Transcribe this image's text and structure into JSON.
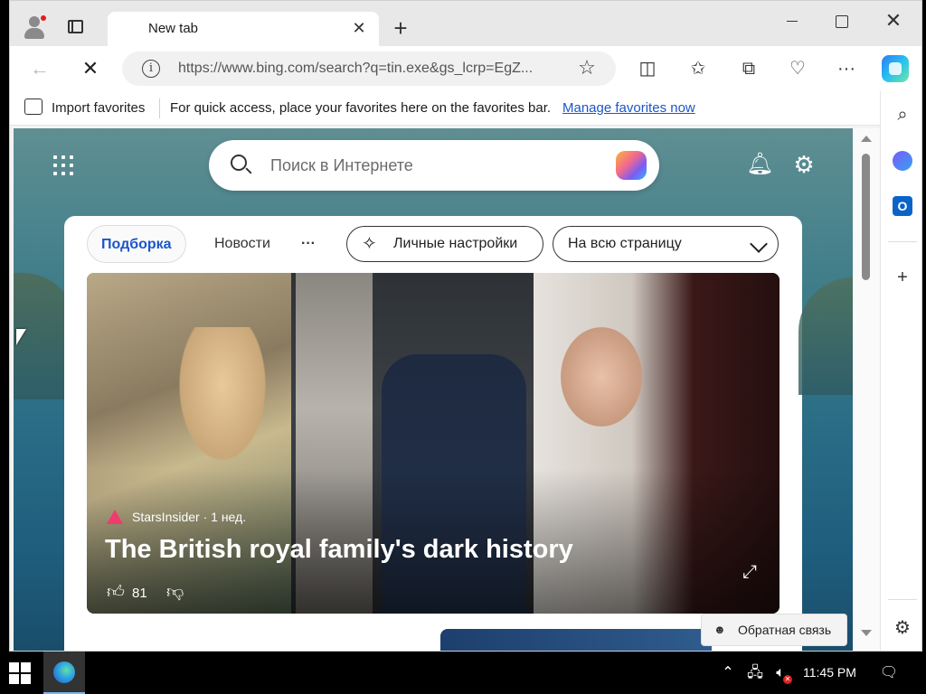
{
  "browser": {
    "tab_title": "New tab",
    "url": "https://www.bing.com/search?q=tin.exe&gs_lcrp=EgZ...",
    "favorites_bar": {
      "import_label": "Import favorites",
      "hint": "For quick access, place your favorites here on the favorites bar.",
      "manage_link": "Manage favorites now"
    }
  },
  "page": {
    "search_placeholder": "Поиск в Интернете",
    "feed_tabs": [
      "Подборка",
      "Новости",
      "···"
    ],
    "personal_settings": "Личные настройки",
    "layout_select": "На всю страницу",
    "hero": {
      "source": "StarsInsider · 1 нед.",
      "headline": "The British royal family's dark history",
      "likes": "81"
    },
    "feedback": "Обратная связь"
  },
  "taskbar": {
    "clock": "11:45 PM"
  },
  "colors": {
    "accent": "#1a56c9",
    "link": "#1a56c9",
    "notification_dot": "#e01e1e"
  }
}
